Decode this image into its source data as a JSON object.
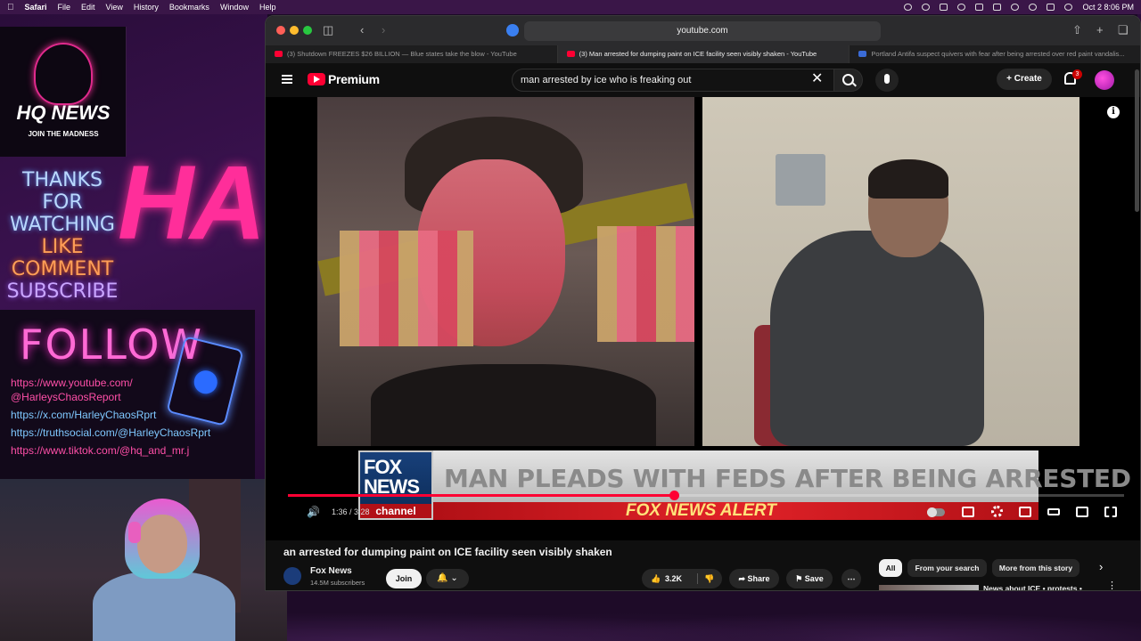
{
  "menubar": {
    "app": "Safari",
    "items": [
      "File",
      "Edit",
      "View",
      "History",
      "Bookmarks",
      "Window",
      "Help"
    ],
    "clock": "Oct 2  8:06 PM"
  },
  "overlay": {
    "logo_title": "HQ NEWS",
    "logo_sub": "JOIN THE MADNESS",
    "thanks_lines": [
      "THANKS",
      "FOR",
      "WATCHING",
      "LIKE",
      "COMMENT",
      "SUBSCRIBE"
    ],
    "ha_text": "HA",
    "follow": "FOLLOW",
    "links": [
      "https://www.youtube.com/",
      "@HarleysChaosReport",
      "https://x.com/HarleyChaosRprt",
      "https://truthsocial.com/@HarleyChaosRprt",
      "https://www.tiktok.com/@hq_and_mr.j"
    ]
  },
  "browser": {
    "address": "youtube.com",
    "tabs": [
      {
        "label": "(3) Shutdown FREEZES $26 BILLION — Blue states take the blow - YouTube",
        "fav": "youtube"
      },
      {
        "label": "(3) Man arrested for dumping paint on ICE facility seen visibly shaken - YouTube",
        "fav": "youtube",
        "active": true
      },
      {
        "label": "Portland Antifa suspect quivers with fear after being arrested over red paint vandalis...",
        "fav": "news"
      }
    ]
  },
  "youtube": {
    "brand": "Premium",
    "search_value": "man arrested by ice who is freaking out",
    "create_label": "Create",
    "notif_count": "3",
    "video": {
      "headline": "MAN PLEADS WITH FEDS AFTER BEING ARRESTED",
      "alert": "FOX NEWS ALERT",
      "fox_line1": "FOX",
      "fox_line2": "NEWS",
      "fox_line3": "channel",
      "time": "1:36 / 3:28",
      "progress": 0.4615,
      "info": "i"
    },
    "title": "an arrested for dumping paint on ICE facility seen visibly shaken",
    "channel": "Fox News",
    "subscribers": "14.5M subscribers",
    "join_label": "Join",
    "likes": "3.2K",
    "share_label": "Share",
    "save_label": "Save",
    "chips": [
      "All",
      "From your search",
      "More from this story"
    ],
    "rec_title": "News about ICE • protests •"
  },
  "colors": {
    "accent": "#ff0033",
    "overlay_pink": "#ff2e9a",
    "fox_red": "#b11016"
  }
}
